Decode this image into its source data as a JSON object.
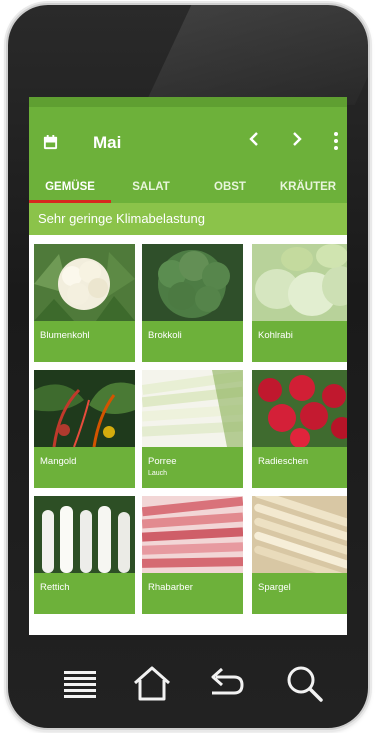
{
  "header": {
    "title": "Mai"
  },
  "tabs": [
    {
      "label": "GEMÜSE",
      "active": true
    },
    {
      "label": "SALAT",
      "active": false
    },
    {
      "label": "OBST",
      "active": false
    },
    {
      "label": "KRÄUTER",
      "active": false
    }
  ],
  "section": {
    "title": "Sehr geringe Klimabelastung"
  },
  "items": [
    {
      "name": "Blumenkohl",
      "sub": ""
    },
    {
      "name": "Brokkoli",
      "sub": ""
    },
    {
      "name": "Kohlrabi",
      "sub": ""
    },
    {
      "name": "Mangold",
      "sub": ""
    },
    {
      "name": "Porree",
      "sub": "Lauch"
    },
    {
      "name": "Radieschen",
      "sub": ""
    },
    {
      "name": "Rettich",
      "sub": ""
    },
    {
      "name": "Rhabarber",
      "sub": ""
    },
    {
      "name": "Spargel",
      "sub": ""
    }
  ],
  "colors": {
    "primary_green": "#6db13a",
    "section_green": "#8bc34a",
    "tab_indicator": "#d7281e"
  },
  "icons": [
    "calendar-icon",
    "chevron-left-icon",
    "chevron-right-icon",
    "more-vertical-icon",
    "menu-icon",
    "home-icon",
    "back-icon",
    "search-icon"
  ]
}
